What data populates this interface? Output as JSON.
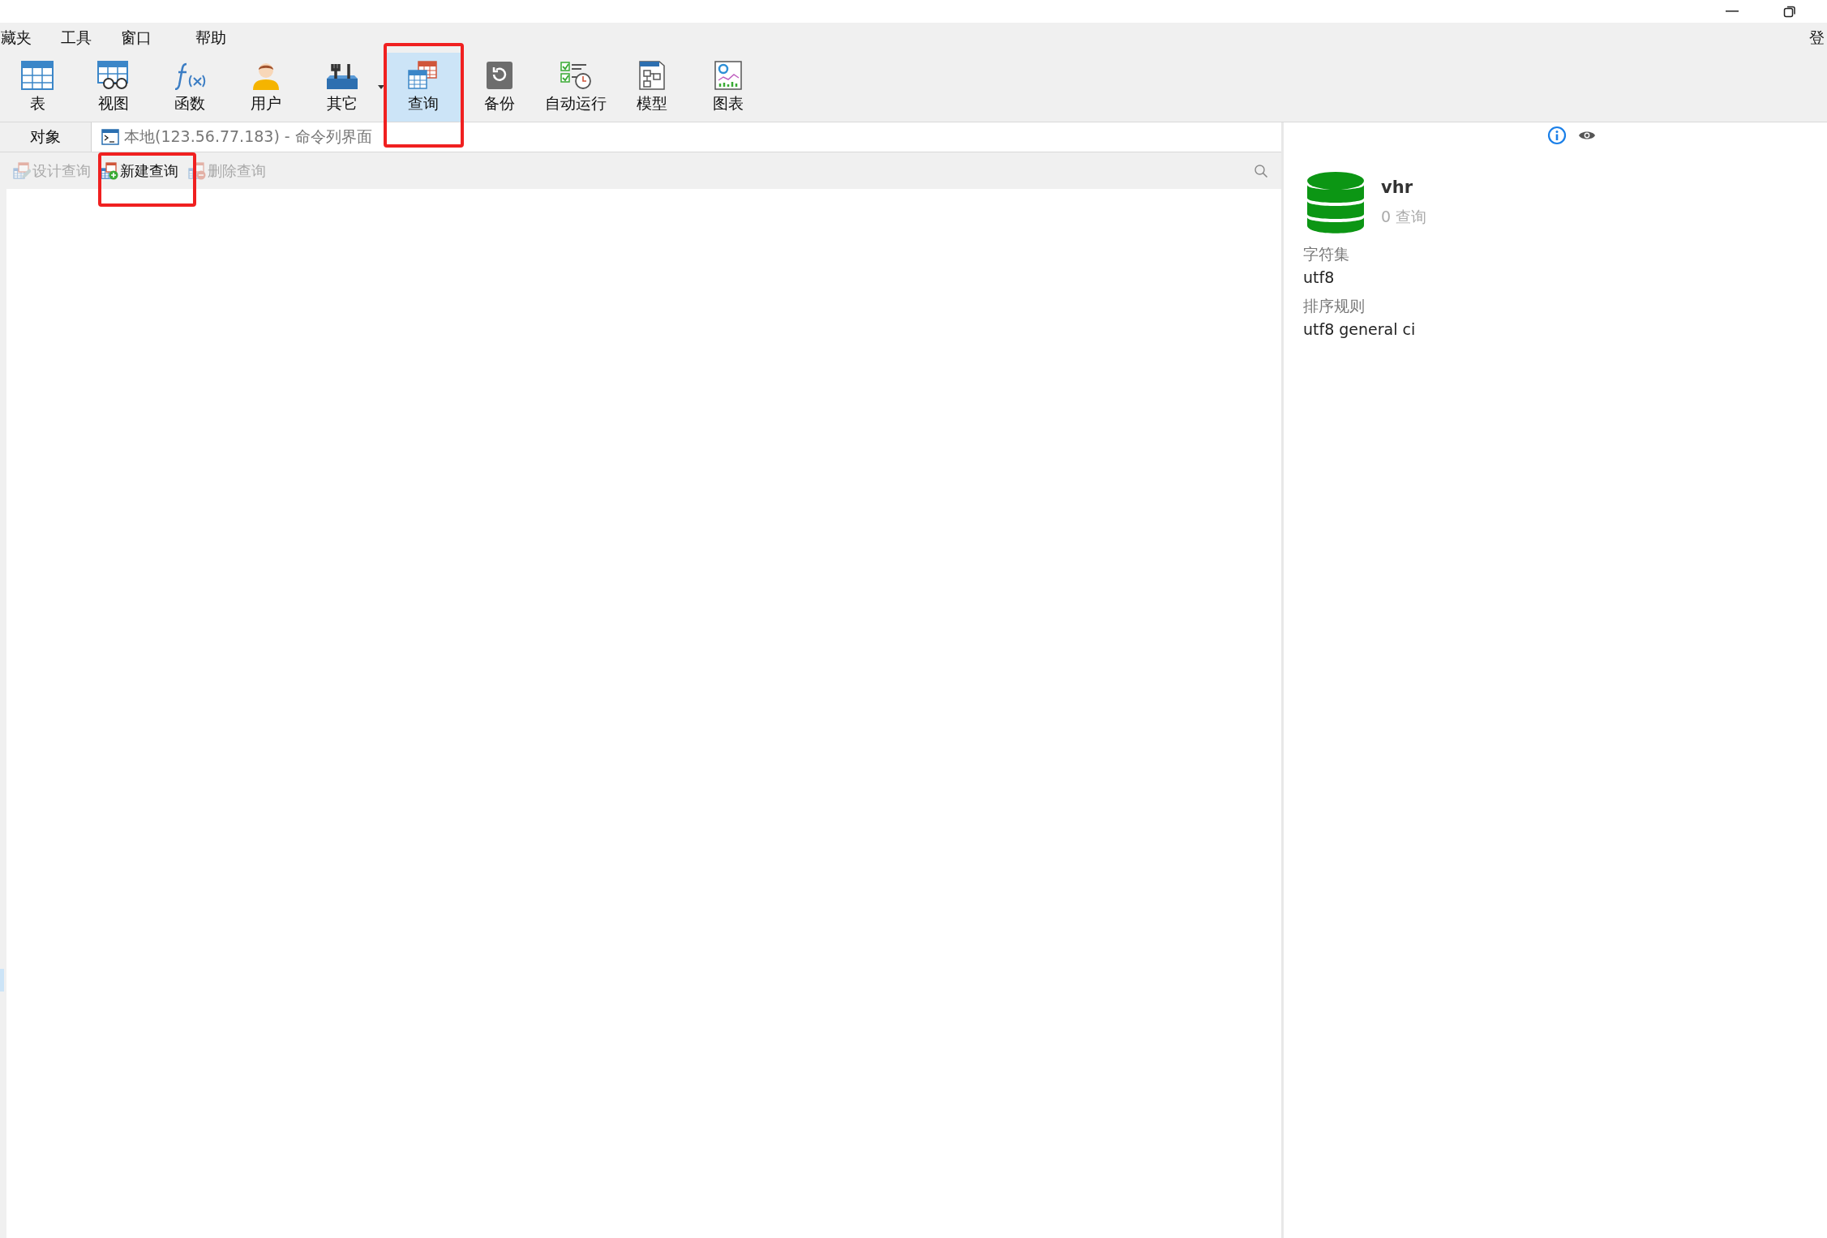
{
  "menu": [
    "藏夹",
    "工具",
    "窗口",
    "帮助"
  ],
  "account_link": "登",
  "toolbar": [
    {
      "label": "表",
      "kind": "table",
      "selected": false,
      "dropdown": false
    },
    {
      "label": "视图",
      "kind": "view",
      "selected": false,
      "dropdown": false
    },
    {
      "label": "函数",
      "kind": "function",
      "selected": false,
      "dropdown": false
    },
    {
      "label": "用户",
      "kind": "user",
      "selected": false,
      "dropdown": false
    },
    {
      "label": "其它",
      "kind": "other",
      "selected": false,
      "dropdown": true
    },
    {
      "label": "查询",
      "kind": "query",
      "selected": true,
      "dropdown": false
    },
    {
      "label": "备份",
      "kind": "backup",
      "selected": false,
      "dropdown": false
    },
    {
      "label": "自动运行",
      "kind": "automation",
      "selected": false,
      "dropdown": false
    },
    {
      "label": "模型",
      "kind": "model",
      "selected": false,
      "dropdown": false
    },
    {
      "label": "图表",
      "kind": "chart",
      "selected": false,
      "dropdown": false
    }
  ],
  "tabs": [
    {
      "label": "对象",
      "kind": "plain",
      "selected": true
    },
    {
      "label": "本地(123.56.77.183) - 命令列界面",
      "kind": "console",
      "selected": false
    }
  ],
  "actions": [
    {
      "label": "设计查询",
      "kind": "design",
      "disabled": true
    },
    {
      "label": "新建查询",
      "kind": "new",
      "disabled": false
    },
    {
      "label": "删除查询",
      "kind": "delete",
      "disabled": true
    }
  ],
  "info": {
    "name": "vhr",
    "count": "0 查询",
    "fields": [
      {
        "label": "字符集",
        "value": "utf8"
      },
      {
        "label": "排序规则",
        "value": "utf8 general ci"
      }
    ]
  }
}
